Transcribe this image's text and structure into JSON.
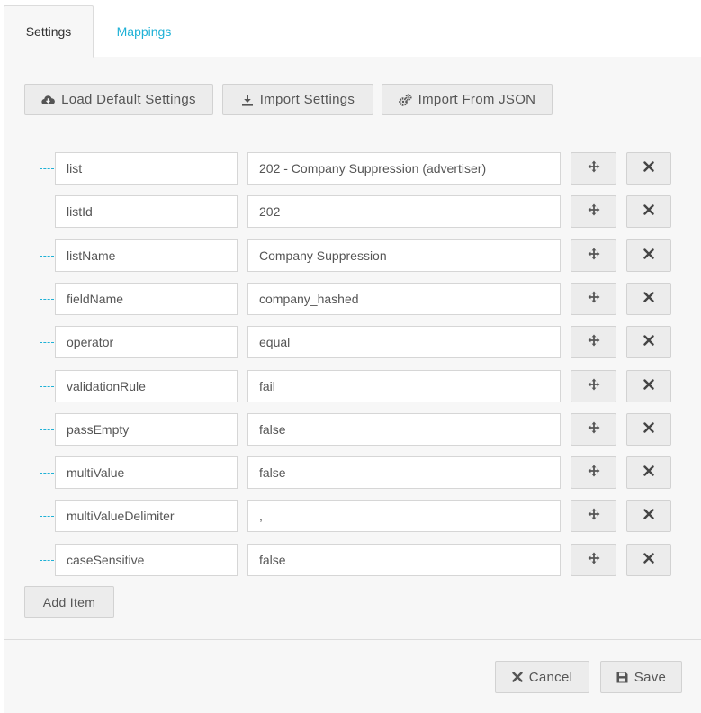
{
  "tabs": [
    {
      "label": "Settings",
      "active": true
    },
    {
      "label": "Mappings",
      "active": false
    }
  ],
  "toolbar": {
    "load_default_label": "Load Default Settings",
    "import_settings_label": "Import Settings",
    "import_json_label": "Import From JSON"
  },
  "items": [
    {
      "key": "list",
      "value": "202 - Company Suppression (advertiser)"
    },
    {
      "key": "listId",
      "value": "202"
    },
    {
      "key": "listName",
      "value": "Company Suppression"
    },
    {
      "key": "fieldName",
      "value": "company_hashed"
    },
    {
      "key": "operator",
      "value": "equal"
    },
    {
      "key": "validationRule",
      "value": "fail"
    },
    {
      "key": "passEmpty",
      "value": "false"
    },
    {
      "key": "multiValue",
      "value": "false"
    },
    {
      "key": "multiValueDelimiter",
      "value": ","
    },
    {
      "key": "caseSensitive",
      "value": "false"
    }
  ],
  "add_item_label": "Add Item",
  "footer": {
    "cancel_label": "Cancel",
    "save_label": "Save"
  },
  "colors": {
    "accent": "#1fb1d6",
    "panel_bg": "#f7f7f7",
    "button_bg": "#ececec",
    "border": "#d2d2d2"
  },
  "icons": {
    "load_default": "cloud-download-icon",
    "import_settings": "download-icon",
    "import_json": "gears-icon",
    "row_move": "move-icon",
    "row_remove": "close-icon",
    "cancel": "close-icon",
    "save": "floppy-disk-icon"
  }
}
